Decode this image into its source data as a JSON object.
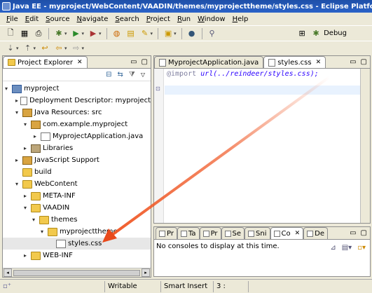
{
  "window": {
    "title": "Java EE - myproject/WebContent/VAADIN/themes/myprojecttheme/styles.css - Eclipse Platfo"
  },
  "menu": [
    "File",
    "Edit",
    "Source",
    "Navigate",
    "Search",
    "Project",
    "Run",
    "Window",
    "Help"
  ],
  "perspective": {
    "label": "Debug"
  },
  "explorer": {
    "tab_label": "Project Explorer",
    "tree": [
      {
        "label": "myproject",
        "icon": "project-icon",
        "twisty": "▾"
      },
      {
        "label": "Deployment Descriptor: myproject",
        "icon": "descriptor-icon",
        "twisty": "▸"
      },
      {
        "label": "Java Resources: src",
        "icon": "java-resources-icon",
        "twisty": "▾"
      },
      {
        "label": "com.example.myproject",
        "icon": "package-icon",
        "twisty": "▾"
      },
      {
        "label": "MyprojectApplication.java",
        "icon": "java-file-icon",
        "twisty": "▸"
      },
      {
        "label": "Libraries",
        "icon": "library-icon",
        "twisty": "▸"
      },
      {
        "label": "JavaScript Support",
        "icon": "javascript-icon",
        "twisty": "▸"
      },
      {
        "label": "build",
        "icon": "folder-icon",
        "twisty": ""
      },
      {
        "label": "WebContent",
        "icon": "folder-icon",
        "twisty": "▾"
      },
      {
        "label": "META-INF",
        "icon": "folder-icon",
        "twisty": "▸"
      },
      {
        "label": "VAADIN",
        "icon": "folder-icon",
        "twisty": "▾"
      },
      {
        "label": "themes",
        "icon": "folder-icon",
        "twisty": "▾"
      },
      {
        "label": "myprojecttheme",
        "icon": "folder-icon",
        "twisty": "▾"
      },
      {
        "label": "styles.css",
        "icon": "css-file-icon",
        "twisty": ""
      },
      {
        "label": "WEB-INF",
        "icon": "folder-icon",
        "twisty": "▸"
      }
    ]
  },
  "editor": {
    "tabs": [
      {
        "label": "MyprojectApplication.java",
        "active": false
      },
      {
        "label": "styles.css",
        "active": true
      }
    ],
    "code": {
      "keyword": "@import",
      "func": "url",
      "arg": "(../reindeer/styles.css);"
    }
  },
  "console": {
    "tabs": [
      "Pr",
      "Ta",
      "Pr",
      "Se",
      "Sni",
      "Co",
      "De"
    ],
    "active_tab": "Co",
    "message": "No consoles to display at this time."
  },
  "status": {
    "writable": "Writable",
    "insert_mode": "Smart Insert",
    "position": "3 :"
  },
  "colors": {
    "titlebar": "#2b63c8",
    "arrow": "#f05a28",
    "keyword": "#7f7f9f",
    "string": "#2a00ff"
  }
}
